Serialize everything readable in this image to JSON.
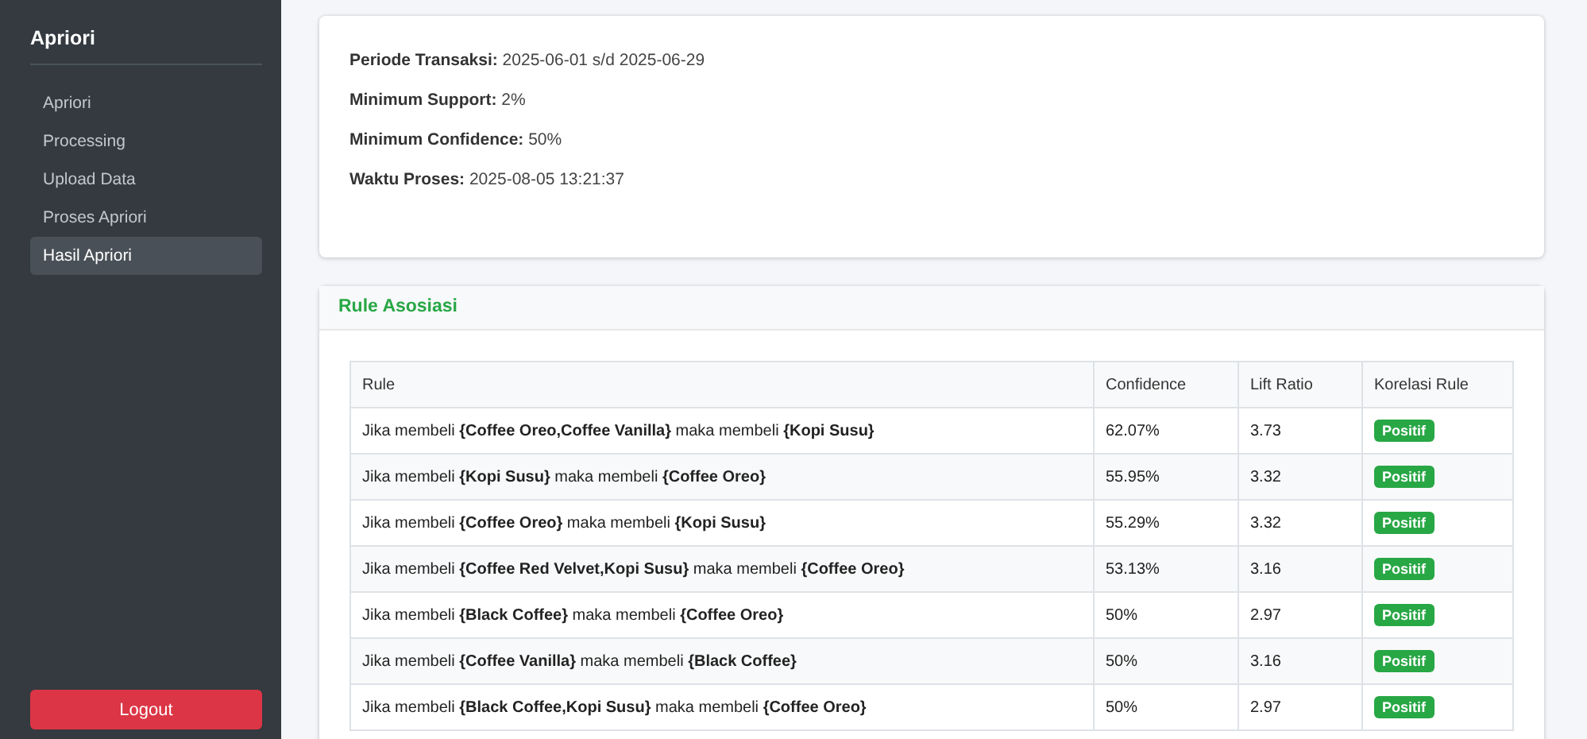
{
  "sidebar": {
    "title": "Apriori",
    "items": [
      {
        "label": "Apriori",
        "selected": false
      },
      {
        "label": "Processing",
        "selected": false
      },
      {
        "label": "Upload Data",
        "selected": false
      },
      {
        "label": "Proses Apriori",
        "selected": false
      },
      {
        "label": "Hasil Apriori",
        "selected": true
      }
    ],
    "logout": "Logout"
  },
  "summary": [
    "**Periode Transaksi:** 2025-06-01 s/d 2025-06-29",
    "**Minimum Support:** 2%",
    "**Minimum Confidence:** 50%",
    "**Waktu Proses:** 2025-08-05 13:21:37"
  ],
  "rules_card": {
    "title": "Rule Asosiasi",
    "table": {
      "columns": [
        "Rule",
        "Confidence",
        "Lift Ratio",
        "Korelasi Rule"
      ],
      "rows": [
        {
          "rule": "Jika membeli **{Coffee Oreo,Coffee Vanilla}** maka membeli **{Kopi Susu}**",
          "confidence": "62.07%",
          "lift": "3.73",
          "correlation": {
            "text": "Positif",
            "kind": "positive"
          }
        },
        {
          "rule": "Jika membeli **{Kopi Susu}** maka membeli **{Coffee Oreo}**",
          "confidence": "55.95%",
          "lift": "3.32",
          "correlation": {
            "text": "Positif",
            "kind": "positive"
          }
        },
        {
          "rule": "Jika membeli **{Coffee Oreo}** maka membeli **{Kopi Susu}**",
          "confidence": "55.29%",
          "lift": "3.32",
          "correlation": {
            "text": "Positif",
            "kind": "positive"
          }
        },
        {
          "rule": "Jika membeli **{Coffee Red Velvet,Kopi Susu}** maka membeli **{Coffee Oreo}**",
          "confidence": "53.13%",
          "lift": "3.16",
          "correlation": {
            "text": "Positif",
            "kind": "positive"
          }
        },
        {
          "rule": "Jika membeli **{Black Coffee}** maka membeli **{Coffee Oreo}**",
          "confidence": "50%",
          "lift": "2.97",
          "correlation": {
            "text": "Positif",
            "kind": "positive"
          }
        },
        {
          "rule": "Jika membeli **{Coffee Vanilla}** maka membeli **{Black Coffee}**",
          "confidence": "50%",
          "lift": "3.16",
          "correlation": {
            "text": "Positif",
            "kind": "positive"
          }
        },
        {
          "rule": "Jika membeli **{Black Coffee,Kopi Susu}** maka membeli **{Coffee Oreo}**",
          "confidence": "50%",
          "lift": "2.97",
          "correlation": {
            "text": "Positif",
            "kind": "positive"
          }
        }
      ]
    }
  }
}
